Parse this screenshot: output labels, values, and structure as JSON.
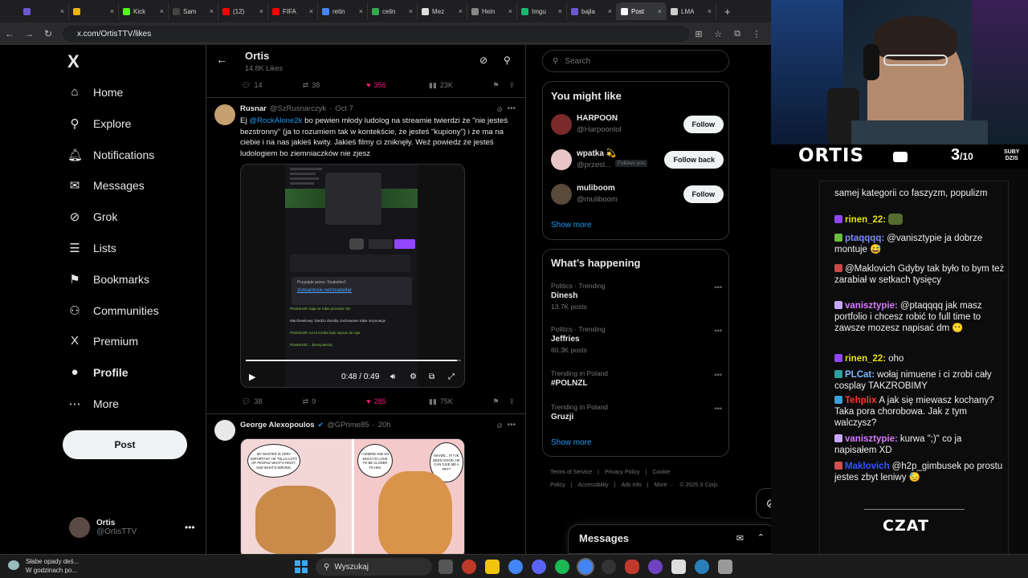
{
  "browser": {
    "tabs": [
      {
        "label": "",
        "color": "#6a5acd"
      },
      {
        "label": "",
        "color": "#f0b400"
      },
      {
        "label": "Kick",
        "color": "#53fc18"
      },
      {
        "label": "Sam",
        "color": "#444444"
      },
      {
        "label": "(12)",
        "color": "#ff0000"
      },
      {
        "label": "FIFA",
        "color": "#ff0000"
      },
      {
        "label": "retin",
        "color": "#4285f4"
      },
      {
        "label": "celin",
        "color": "#34a853"
      },
      {
        "label": "Mez",
        "color": "#dddddd"
      },
      {
        "label": "Hein",
        "color": "#888888"
      },
      {
        "label": "Imgu",
        "color": "#1bb76e"
      },
      {
        "label": "bajla",
        "color": "#6a5acd"
      },
      {
        "label": "Post",
        "color": "#ffffff",
        "active": true
      },
      {
        "label": "LMA",
        "color": "#cccccc"
      }
    ],
    "url": "x.com/OrtisTTV/likes"
  },
  "nav": {
    "logo": "X",
    "items": [
      {
        "label": "Home",
        "icon": "home-icon",
        "glyph": "⌂"
      },
      {
        "label": "Explore",
        "icon": "search-icon",
        "glyph": "⚲"
      },
      {
        "label": "Notifications",
        "icon": "bell-icon",
        "glyph": "🔔︎"
      },
      {
        "label": "Messages",
        "icon": "mail-icon",
        "glyph": "✉"
      },
      {
        "label": "Grok",
        "icon": "grok-icon",
        "glyph": "⊘"
      },
      {
        "label": "Lists",
        "icon": "list-icon",
        "glyph": "☰"
      },
      {
        "label": "Bookmarks",
        "icon": "bookmark-icon",
        "glyph": "⚑"
      },
      {
        "label": "Communities",
        "icon": "communities-icon",
        "glyph": "⚇"
      },
      {
        "label": "Premium",
        "icon": "x-premium-icon",
        "glyph": "X"
      },
      {
        "label": "Profile",
        "icon": "profile-icon",
        "glyph": "●",
        "active": true
      },
      {
        "label": "More",
        "icon": "more-circle-icon",
        "glyph": "⋯"
      }
    ],
    "post_label": "Post",
    "account": {
      "name": "Ortis",
      "handle": "@OrtisTTV"
    }
  },
  "header": {
    "title": "Ortis",
    "subtitle": "14.8K Likes"
  },
  "tweet0_actions": {
    "replies": "14",
    "reposts": "38",
    "likes": "356",
    "views": "23K"
  },
  "tweet1": {
    "name": "Rusnar",
    "handle": "@SzRusnarczyk",
    "sep": "·",
    "date": "Oct 7",
    "text_pre": "Ej ",
    "mention": "@RockAlone2k",
    "text_post": " bo pewien młody ludolog na streamie twierdzi że \"nie jesteś bezstronny\" (ja to rozumiem tak w kontekście, że jesteś \"kupiony\") i że ma na ciebie i na nas jakieś kwity. Jakieś filmy ci zniknęły. Weź powiedz że jesteś ludologiem bo ziemniaczków nie zjesz",
    "video": {
      "time": "0:48 / 0:49",
      "progress": 0.98,
      "pinned_label": "Przypięte przez: Snakeiter1",
      "link": "zloteantosie.net/snakeiter",
      "chat": [
        "Piotrek100: baja se robie przeciez XD",
        "Marchewkowy: bardzo doroślę zachowanie takie insynuacje",
        "Piotrek100: no to trzeba było wyciac do roja",
        "Piotrek100: ...bieraj wiecej"
      ]
    },
    "actions": {
      "replies": "38",
      "reposts": "9",
      "likes": "285",
      "views": "75K"
    }
  },
  "tweet2": {
    "name": "George Alexopoulos",
    "handle": "@GPrime85",
    "sep": "·",
    "date": "20h",
    "comic": [
      "MY MASTER IS VERY IMPORTANT. HE TELLS LOTS OF PEOPLE WHAT'S RIGHT, AND WHAT'S WRONG.",
      "I ADMIRE HIM SO MUCH I'D LOVE TO BE CLOSER TO HIM.",
      "MAYBE... IF I'VE BEEN GOOD, HE CAN GIVE ME A PET?"
    ]
  },
  "right": {
    "search_placeholder": "Search",
    "wtf_title": "You might like",
    "wtf": [
      {
        "name": "HARPOON",
        "handle": "@Harpoonlol",
        "button": "Follow",
        "follows_you": "",
        "avatar": "#7a2a2a"
      },
      {
        "name": "wpatka 💫",
        "handle": "@przesl...",
        "button": "Follow back",
        "follows_you": "Follows you",
        "avatar": "#e8c6c6"
      },
      {
        "name": "muliboom",
        "handle": "@muliboom",
        "button": "Follow",
        "follows_you": "",
        "avatar": "#5a4a3a"
      }
    ],
    "show_more": "Show more",
    "happening_title": "What’s happening",
    "trends": [
      {
        "context": "Politics · Trending",
        "title": "Dinesh",
        "count": "13.7K posts"
      },
      {
        "context": "Politics · Trending",
        "title": "Jeffries",
        "count": "60.3K posts"
      },
      {
        "context": "Trending in Poland",
        "title": "#POLNZL",
        "count": ""
      },
      {
        "context": "Trending in Poland",
        "title": "Gruzji",
        "count": ""
      }
    ],
    "footer": [
      "Terms of Service",
      "|",
      "Privacy Policy",
      "|",
      "Cookie Policy",
      "|",
      "Accessibility",
      "|",
      "Ads info",
      "|",
      "More ···",
      "© 2025 X Corp."
    ],
    "messages_label": "Messages"
  },
  "stream": {
    "brand": "ORTIS",
    "subs_value": "3",
    "subs_total": "/10",
    "subs_label_1": "SUBY",
    "subs_label_2": "DZIS",
    "chat": [
      {
        "user": "",
        "text": "samej kategorii co faszyzm, populizm",
        "color": "#efeff1",
        "badge": ""
      },
      {
        "user": "rinen_22:",
        "text": "",
        "color": "#e6e600",
        "badge": "#9147ff",
        "emote": "#556b2f"
      },
      {
        "user": "ptaqqqq:",
        "text": "@vanisztypie ja dobrze montuje 😅",
        "color": "#7d8cff",
        "badge": "#6bbd3a"
      },
      {
        "user": "",
        "text": "@Maklovich Gdyby tak było to bym też zarabiał w setkach tysięcy",
        "color": "#efeff1",
        "badge": "#c94a4a"
      },
      {
        "user": "vanisztypie:",
        "text": "@ptaqqqq jak masz portfolio i chcesz robić to full time to zawsze mozesz napisać dm 😶",
        "color": "#d97dff",
        "badge": "#c9a8ff"
      },
      {
        "user": "rinen_22:",
        "text": "oho",
        "color": "#e6e600",
        "badge": "#9147ff"
      },
      {
        "user": "PLCat:",
        "text": "wołaj nimuene i ci zrobi cały cosplay TAKZROBIMY",
        "color": "#7db7ff",
        "badge": "#2ea0a0"
      },
      {
        "user": "Tehplix",
        "text": "A jak się miewasz kochany? Taka pora chorobowa. Jak z tym walczysz?",
        "color": "#ff3333",
        "badge": "#3aa0d8"
      },
      {
        "user": "vanisztypie:",
        "text": "kurwa \";)\" co ja napisałem XD",
        "color": "#d97dff",
        "badge": "#c9a8ff"
      },
      {
        "user": "Maklovich",
        "text": "@h2p_gimbusek po prostu jestes zbyt leniwy 😓",
        "color": "#3355ff",
        "badge": "#d05050"
      }
    ],
    "czat": "CZAT"
  },
  "taskbar": {
    "weather_line1": "Słabe opady deś...",
    "weather_line2": "W godzinach po...",
    "search_label": "Wyszukaj"
  }
}
